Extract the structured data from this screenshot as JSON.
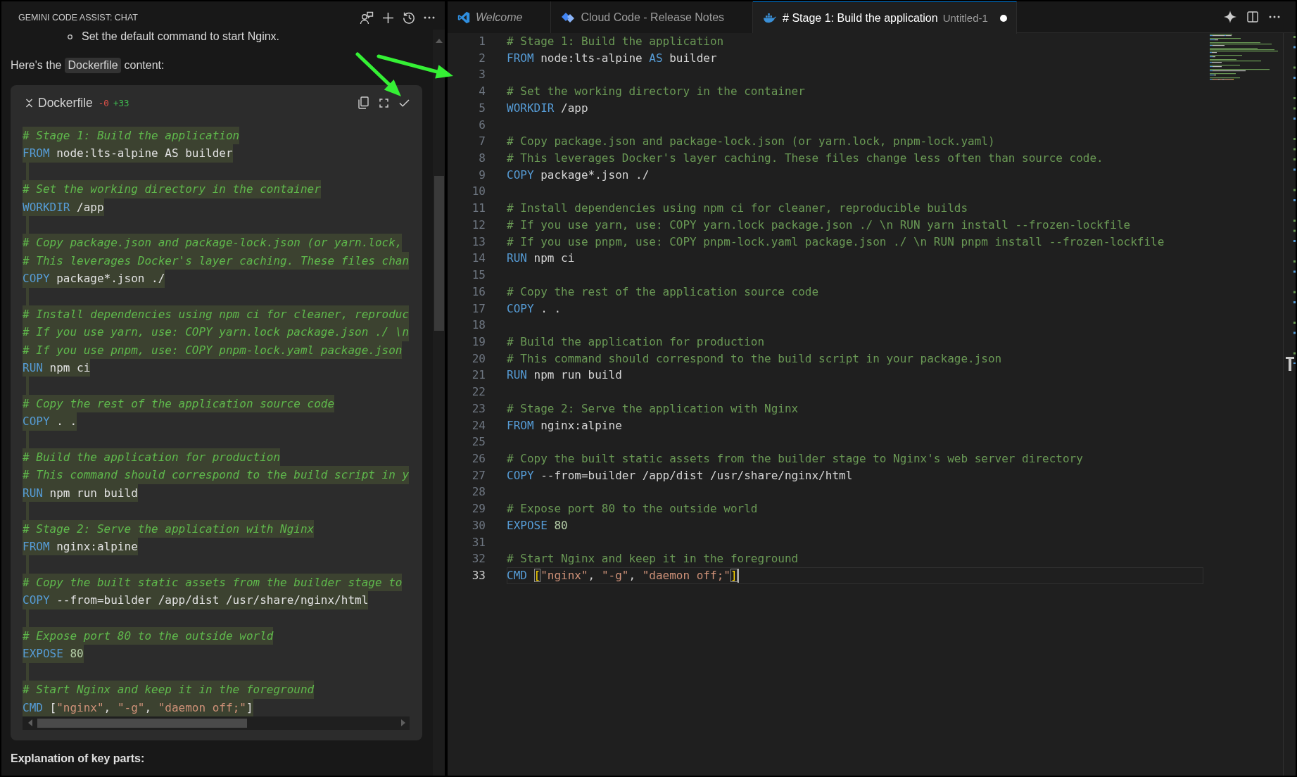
{
  "chat_panel": {
    "title": "GEMINI CODE ASSIST: CHAT",
    "bullet": "Set the default command to start Nginx.",
    "intro": {
      "before": "Here's the",
      "code": "Dockerfile",
      "after": "content:"
    },
    "code_block": {
      "filename": "Dockerfile",
      "removed": "-0",
      "added": "+33",
      "lines": [
        {
          "kind": "comment",
          "text": "# Stage 1: Build the application"
        },
        {
          "kind": "code",
          "tokens": [
            {
              "kind": "keyword",
              "text": "FROM"
            },
            {
              "kind": "plain",
              "text": " node:lts-alpine AS builder"
            }
          ]
        },
        {
          "kind": "blank"
        },
        {
          "kind": "comment",
          "text": "# Set the working directory in the container"
        },
        {
          "kind": "code",
          "tokens": [
            {
              "kind": "keyword",
              "text": "WORKDIR"
            },
            {
              "kind": "plain",
              "text": " /app"
            }
          ]
        },
        {
          "kind": "blank"
        },
        {
          "kind": "comment",
          "text": "# Copy package.json and package-lock.json (or yarn.lock,"
        },
        {
          "kind": "comment",
          "text": "# This leverages Docker's layer caching. These files chan"
        },
        {
          "kind": "code",
          "tokens": [
            {
              "kind": "keyword",
              "text": "COPY"
            },
            {
              "kind": "plain",
              "text": " package*.json ./"
            }
          ]
        },
        {
          "kind": "blank"
        },
        {
          "kind": "comment",
          "text": "# Install dependencies using npm ci for cleaner, reproduc"
        },
        {
          "kind": "comment",
          "text": "# If you use yarn, use: COPY yarn.lock package.json ./ \\n"
        },
        {
          "kind": "comment",
          "text": "# If you use pnpm, use: COPY pnpm-lock.yaml package.json"
        },
        {
          "kind": "code",
          "tokens": [
            {
              "kind": "keyword",
              "text": "RUN"
            },
            {
              "kind": "plain",
              "text": " npm ci"
            }
          ]
        },
        {
          "kind": "blank"
        },
        {
          "kind": "comment",
          "text": "# Copy the rest of the application source code"
        },
        {
          "kind": "code",
          "tokens": [
            {
              "kind": "keyword",
              "text": "COPY"
            },
            {
              "kind": "plain",
              "text": " . ."
            }
          ]
        },
        {
          "kind": "blank"
        },
        {
          "kind": "comment",
          "text": "# Build the application for production"
        },
        {
          "kind": "comment",
          "text": "# This command should correspond to the build script in y"
        },
        {
          "kind": "code",
          "tokens": [
            {
              "kind": "keyword",
              "text": "RUN"
            },
            {
              "kind": "plain",
              "text": " npm run build"
            }
          ]
        },
        {
          "kind": "blank"
        },
        {
          "kind": "comment",
          "text": "# Stage 2: Serve the application with Nginx"
        },
        {
          "kind": "code",
          "tokens": [
            {
              "kind": "keyword",
              "text": "FROM"
            },
            {
              "kind": "plain",
              "text": " nginx:alpine"
            }
          ]
        },
        {
          "kind": "blank"
        },
        {
          "kind": "comment",
          "text": "# Copy the built static assets from the builder stage to"
        },
        {
          "kind": "code",
          "tokens": [
            {
              "kind": "keyword",
              "text": "COPY"
            },
            {
              "kind": "plain",
              "text": " --from=builder /app/dist /usr/share/nginx/html"
            }
          ]
        },
        {
          "kind": "blank"
        },
        {
          "kind": "comment",
          "text": "# Expose port 80 to the outside world"
        },
        {
          "kind": "code",
          "tokens": [
            {
              "kind": "keyword",
              "text": "EXPOSE"
            },
            {
              "kind": "number",
              "text": " 80"
            }
          ]
        },
        {
          "kind": "blank"
        },
        {
          "kind": "comment",
          "text": "# Start Nginx and keep it in the foreground"
        },
        {
          "kind": "code",
          "tokens": [
            {
              "kind": "keyword",
              "text": "CMD"
            },
            {
              "kind": "plain",
              "text": " ["
            },
            {
              "kind": "string",
              "text": "\"nginx\""
            },
            {
              "kind": "plain",
              "text": ", "
            },
            {
              "kind": "string",
              "text": "\"-g\""
            },
            {
              "kind": "plain",
              "text": ", "
            },
            {
              "kind": "string",
              "text": "\"daemon off;\""
            },
            {
              "kind": "plain",
              "text": "]"
            }
          ]
        }
      ]
    },
    "footer_heading": "Explanation of key parts:"
  },
  "editor": {
    "tabs": [
      {
        "kind": "welcome",
        "label": "Welcome",
        "preview": true,
        "selected": false,
        "modified": false
      },
      {
        "kind": "notes",
        "label": "Cloud Code - Release Notes",
        "preview": false,
        "selected": false,
        "modified": false
      },
      {
        "kind": "file",
        "label": "# Stage 1: Build the application",
        "description": "Untitled-1",
        "preview": false,
        "selected": true,
        "modified": true
      }
    ],
    "lines": [
      {
        "number": "1",
        "current": false,
        "kind": "comment",
        "text": "# Stage 1: Build the application"
      },
      {
        "number": "2",
        "current": false,
        "kind": "code",
        "tokens": [
          {
            "kind": "keyword",
            "text": "FROM"
          },
          {
            "kind": "plain",
            "text": " node:lts-alpine "
          },
          {
            "kind": "keyword",
            "text": "AS"
          },
          {
            "kind": "plain",
            "text": " builder"
          }
        ]
      },
      {
        "number": "3",
        "current": false,
        "kind": "blank"
      },
      {
        "number": "4",
        "current": false,
        "kind": "comment",
        "text": "# Set the working directory in the container"
      },
      {
        "number": "5",
        "current": false,
        "kind": "code",
        "tokens": [
          {
            "kind": "keyword",
            "text": "WORKDIR"
          },
          {
            "kind": "plain",
            "text": " /app"
          }
        ]
      },
      {
        "number": "6",
        "current": false,
        "kind": "blank"
      },
      {
        "number": "7",
        "current": false,
        "kind": "comment",
        "text": "# Copy package.json and package-lock.json (or yarn.lock, pnpm-lock.yaml)"
      },
      {
        "number": "8",
        "current": false,
        "kind": "comment",
        "text": "# This leverages Docker's layer caching. These files change less often than source code."
      },
      {
        "number": "9",
        "current": false,
        "kind": "code",
        "tokens": [
          {
            "kind": "keyword",
            "text": "COPY"
          },
          {
            "kind": "plain",
            "text": " package*.json ./"
          }
        ]
      },
      {
        "number": "10",
        "current": false,
        "kind": "blank"
      },
      {
        "number": "11",
        "current": false,
        "kind": "comment",
        "text": "# Install dependencies using npm ci for cleaner, reproducible builds"
      },
      {
        "number": "12",
        "current": false,
        "kind": "comment",
        "text": "# If you use yarn, use: COPY yarn.lock package.json ./ \\n RUN yarn install --frozen-lockfile"
      },
      {
        "number": "13",
        "current": false,
        "kind": "comment",
        "text": "# If you use pnpm, use: COPY pnpm-lock.yaml package.json ./ \\n RUN pnpm install --frozen-lockfile"
      },
      {
        "number": "14",
        "current": false,
        "kind": "code",
        "tokens": [
          {
            "kind": "keyword",
            "text": "RUN"
          },
          {
            "kind": "plain",
            "text": " npm ci"
          }
        ]
      },
      {
        "number": "15",
        "current": false,
        "kind": "blank"
      },
      {
        "number": "16",
        "current": false,
        "kind": "comment",
        "text": "# Copy the rest of the application source code"
      },
      {
        "number": "17",
        "current": false,
        "kind": "code",
        "tokens": [
          {
            "kind": "keyword",
            "text": "COPY"
          },
          {
            "kind": "plain",
            "text": " . ."
          }
        ]
      },
      {
        "number": "18",
        "current": false,
        "kind": "blank"
      },
      {
        "number": "19",
        "current": false,
        "kind": "comment",
        "text": "# Build the application for production"
      },
      {
        "number": "20",
        "current": false,
        "kind": "comment",
        "text": "# This command should correspond to the build script in your package.json"
      },
      {
        "number": "21",
        "current": false,
        "kind": "code",
        "tokens": [
          {
            "kind": "keyword",
            "text": "RUN"
          },
          {
            "kind": "plain",
            "text": " npm run build"
          }
        ]
      },
      {
        "number": "22",
        "current": false,
        "kind": "blank"
      },
      {
        "number": "23",
        "current": false,
        "kind": "comment",
        "text": "# Stage 2: Serve the application with Nginx"
      },
      {
        "number": "24",
        "current": false,
        "kind": "code",
        "tokens": [
          {
            "kind": "keyword",
            "text": "FROM"
          },
          {
            "kind": "plain",
            "text": " nginx:alpine"
          }
        ]
      },
      {
        "number": "25",
        "current": false,
        "kind": "blank"
      },
      {
        "number": "26",
        "current": false,
        "kind": "comment",
        "text": "# Copy the built static assets from the builder stage to Nginx's web server directory"
      },
      {
        "number": "27",
        "current": false,
        "kind": "code",
        "tokens": [
          {
            "kind": "keyword",
            "text": "COPY"
          },
          {
            "kind": "plain",
            "text": " --from=builder /app/dist /usr/share/nginx/html"
          }
        ]
      },
      {
        "number": "28",
        "current": false,
        "kind": "blank"
      },
      {
        "number": "29",
        "current": false,
        "kind": "comment",
        "text": "# Expose port 80 to the outside world"
      },
      {
        "number": "30",
        "current": false,
        "kind": "code",
        "tokens": [
          {
            "kind": "keyword",
            "text": "EXPOSE"
          },
          {
            "kind": "number",
            "text": " 80"
          }
        ]
      },
      {
        "number": "31",
        "current": false,
        "kind": "blank"
      },
      {
        "number": "32",
        "current": false,
        "kind": "comment",
        "text": "# Start Nginx and keep it in the foreground"
      },
      {
        "number": "33",
        "current": true,
        "kind": "code",
        "tokens": [
          {
            "kind": "keyword",
            "text": "CMD "
          },
          {
            "kind": "bracket",
            "text": "["
          },
          {
            "kind": "string",
            "text": "\"nginx\""
          },
          {
            "kind": "plain",
            "text": ", "
          },
          {
            "kind": "string",
            "text": "\"-g\""
          },
          {
            "kind": "plain",
            "text": ", "
          },
          {
            "kind": "string",
            "text": "\"daemon off;\""
          },
          {
            "kind": "bracket",
            "text": "]"
          }
        ]
      }
    ]
  }
}
